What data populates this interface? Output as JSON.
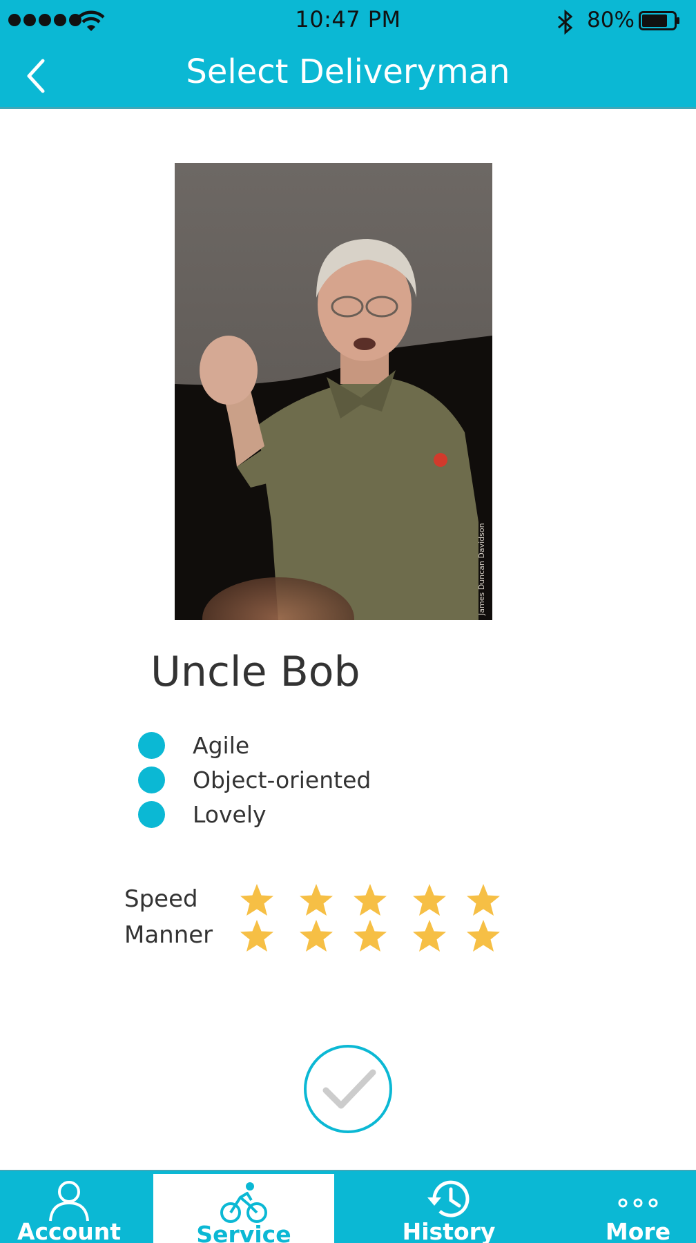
{
  "status_bar": {
    "time": "10:47 PM",
    "battery_percent": "80%",
    "battery_level": 0.8,
    "signal_bars": 5,
    "icons": [
      "signal-dots-icon",
      "wifi-icon",
      "bluetooth-icon",
      "battery-icon"
    ]
  },
  "nav": {
    "title": "Select Deliveryman",
    "back_icon": "chevron-left-icon"
  },
  "profile": {
    "name": "Uncle Bob",
    "photo_credit": "James Duncan Davidson",
    "traits": [
      {
        "label": "Agile"
      },
      {
        "label": "Object-oriented"
      },
      {
        "label": "Lovely"
      }
    ]
  },
  "ratings": [
    {
      "label": "Speed",
      "stars": 5,
      "max": 5
    },
    {
      "label": "Manner",
      "stars": 5,
      "max": 5
    }
  ],
  "confirm": {
    "icon": "checkmark-icon"
  },
  "tabs": [
    {
      "label": "Account",
      "icon": "person-icon",
      "active": false
    },
    {
      "label": "Service",
      "icon": "bicycle-icon",
      "active": true
    },
    {
      "label": "History",
      "icon": "history-icon",
      "active": false
    },
    {
      "label": "More",
      "icon": "more-dots-icon",
      "active": false
    }
  ],
  "colors": {
    "accent": "#0bb8d4",
    "star": "#f6bf45",
    "text": "#333333",
    "check": "#cccccc"
  }
}
